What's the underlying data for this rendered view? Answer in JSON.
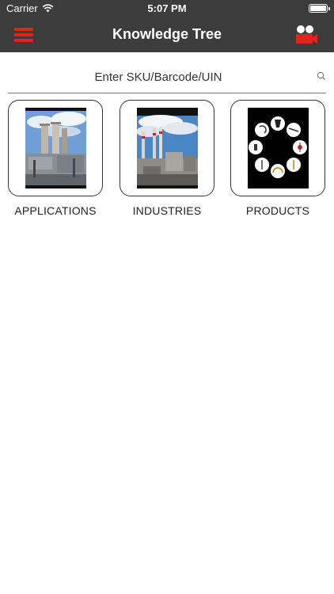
{
  "status_bar": {
    "carrier": "Carrier",
    "time": "5:07 PM"
  },
  "nav": {
    "title": "Knowledge Tree",
    "menu_icon": "hamburger-menu-icon",
    "video_icon": "video-camera-icon",
    "accent_color": "#e2231a",
    "bar_color": "#3c3c3c"
  },
  "search": {
    "placeholder": "Enter SKU/Barcode/UIN",
    "value": "",
    "icon": "search-icon"
  },
  "tiles": [
    {
      "label": "APPLICATIONS",
      "image": "industrial-towers-photo"
    },
    {
      "label": "INDUSTRIES",
      "image": "factory-smokestacks-photo"
    },
    {
      "label": "PRODUCTS",
      "image": "safety-equipment-collage"
    }
  ]
}
